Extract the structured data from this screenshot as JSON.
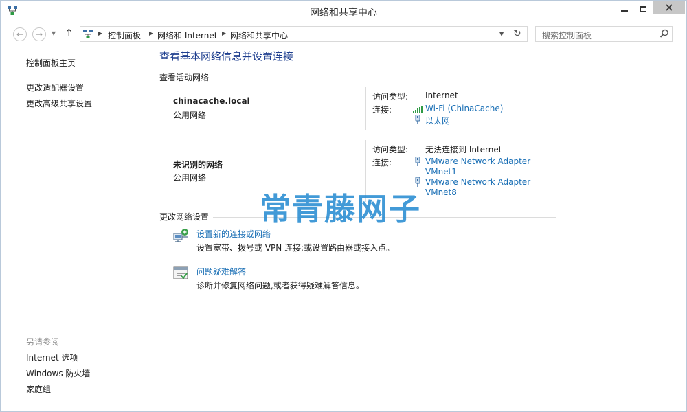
{
  "window": {
    "title": "网络和共享中心",
    "controls": {
      "minimize_icon": "minimize-icon",
      "maximize_icon": "maximize-icon",
      "close_icon": "close-icon"
    }
  },
  "address_bar": {
    "breadcrumbs": [
      "控制面板",
      "网络和 Internet",
      "网络和共享中心"
    ]
  },
  "search": {
    "placeholder": "搜索控制面板"
  },
  "sidebar": {
    "home_link": "控制面板主页",
    "links": [
      "更改适配器设置",
      "更改高级共享设置"
    ],
    "see_also_header": "另请参阅",
    "see_also": [
      "Internet 选项",
      "Windows 防火墙",
      "家庭组"
    ]
  },
  "main": {
    "title": "查看基本网络信息并设置连接",
    "active_networks_header": "查看活动网络",
    "networks": [
      {
        "name": "chinacache.local",
        "type": "公用网络",
        "access_label": "访问类型:",
        "access_value": "Internet",
        "connections_label": "连接:",
        "connections": [
          {
            "label": "Wi-Fi (ChinaCache)",
            "icon": "wifi-signal-icon"
          },
          {
            "label": "以太网",
            "icon": "ethernet-icon"
          }
        ]
      },
      {
        "name": "未识别的网络",
        "type": "公用网络",
        "access_label": "访问类型:",
        "access_value": "无法连接到 Internet",
        "connections_label": "连接:",
        "connections": [
          {
            "label": "VMware Network Adapter VMnet1",
            "line1": "VMware Network Adapter",
            "line2": "VMnet1",
            "icon": "ethernet-icon"
          },
          {
            "label": "VMware Network Adapter VMnet8",
            "line1": "VMware Network Adapter",
            "line2": "VMnet8",
            "icon": "ethernet-icon"
          }
        ]
      }
    ],
    "change_settings_header": "更改网络设置",
    "tasks": [
      {
        "link": "设置新的连接或网络",
        "desc": "设置宽带、拨号或 VPN 连接;或设置路由器或接入点。",
        "icon": "new-connection-icon"
      },
      {
        "link": "问题疑难解答",
        "desc": "诊断并修复网络问题,或者获得疑难解答信息。",
        "icon": "troubleshoot-icon"
      }
    ]
  },
  "watermark": {
    "text": "常青藤网子"
  },
  "colors": {
    "link": "#1a6fb5",
    "title": "#1f3f8f",
    "close_button": "#c7c7c7",
    "divider": "#dcdcdc"
  }
}
